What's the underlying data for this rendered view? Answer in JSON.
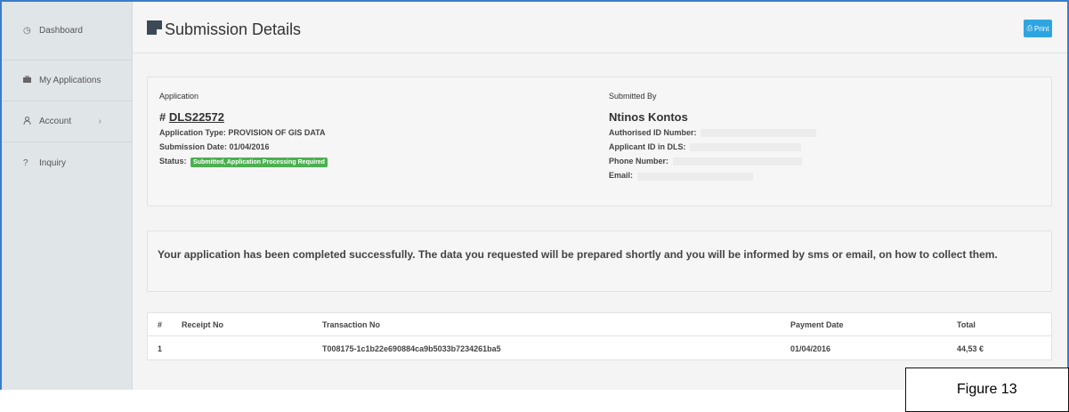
{
  "sidebar": {
    "items": [
      {
        "label": "Dashboard",
        "icon": "clock-icon"
      },
      {
        "label": "My Applications",
        "icon": "briefcase-icon"
      },
      {
        "label": "Account",
        "icon": "user-icon"
      },
      {
        "label": "Inquiry",
        "icon": "help-icon"
      }
    ]
  },
  "header": {
    "title": "Submission Details",
    "print_label": "Print"
  },
  "application": {
    "heading": "Application",
    "number_prefix": "# ",
    "number": "DLS22572",
    "type": "Application Type: PROVISION OF GIS DATA",
    "submission_date": "Submission Date: 01/04/2016",
    "status_label": "Status:",
    "status_value": "Submitted, Application Processing Required"
  },
  "submitted_by": {
    "heading": "Submitted By",
    "name": "Ntinos Kontos",
    "authorised_id_label": "Authorised ID Number:",
    "applicant_id_label": "Applicant ID in DLS:",
    "phone_label": "Phone Number:",
    "email_label": "Email:"
  },
  "message": "Your application has been completed successfully. The data you requested will be prepared shortly and you will be informed by sms or email, on how to collect them.",
  "table": {
    "headers": [
      "#",
      "Receipt No",
      "Transaction No",
      "Payment Date",
      "Total"
    ],
    "rows": [
      [
        "1",
        "",
        "T008175-1c1b22e690884ca9b5033b7234261ba5",
        "01/04/2016",
        "44,53 €"
      ]
    ]
  },
  "caption": "Figure 13",
  "colors": {
    "accent": "#2fa5e0",
    "status_green": "#4caf50",
    "frame_border": "#3a7dc9"
  }
}
